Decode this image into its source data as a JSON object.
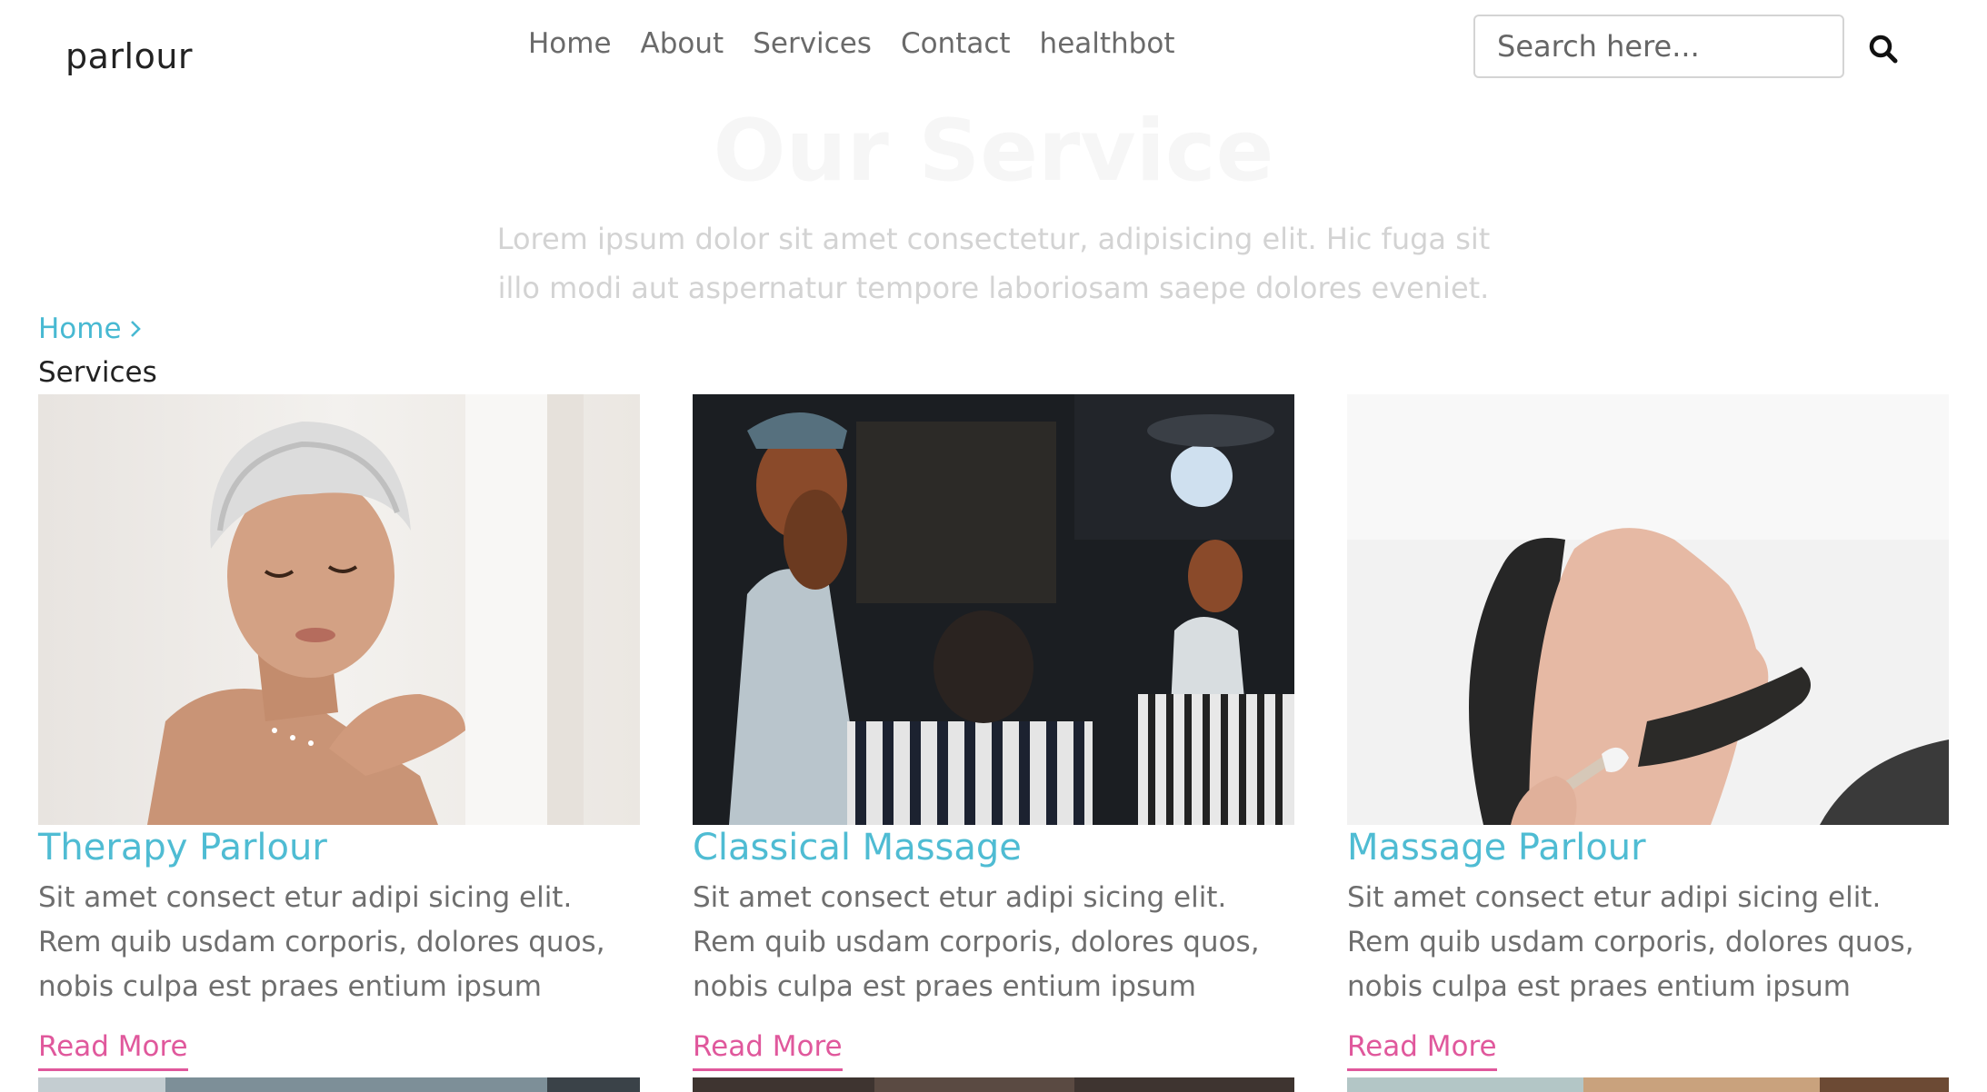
{
  "header": {
    "logo": "parlour",
    "nav": [
      "Home",
      "About",
      "Services",
      "Contact",
      "healthbot"
    ],
    "search_placeholder": "Search here..."
  },
  "hero": {
    "title": "Our Service",
    "text": "Lorem ipsum dolor sit amet consectetur, adipisicing elit. Hic fuga sit illo modi aut aspernatur tempore laboriosam saepe dolores eveniet."
  },
  "breadcrumb": {
    "home": "Home",
    "current": "Services"
  },
  "cards": [
    {
      "title": "Therapy Parlour",
      "text": "Sit amet consect etur adipi sicing elit. Rem quib usdam corporis, dolores quos, nobis culpa est praes entium ipsum",
      "link": "Read More"
    },
    {
      "title": "Classical Massage",
      "text": "Sit amet consect etur adipi sicing elit. Rem quib usdam corporis, dolores quos, nobis culpa est praes entium ipsum",
      "link": "Read More"
    },
    {
      "title": "Massage Parlour",
      "text": "Sit amet consect etur adipi sicing elit. Rem quib usdam corporis, dolores quos, nobis culpa est praes entium ipsum",
      "link": "Read More"
    }
  ],
  "colors": {
    "accent_blue": "#4fbcd3",
    "accent_pink": "#e0589c",
    "text_gray": "#6e6e6e"
  },
  "icons": [
    "search-icon",
    "chevron-right-icon"
  ]
}
